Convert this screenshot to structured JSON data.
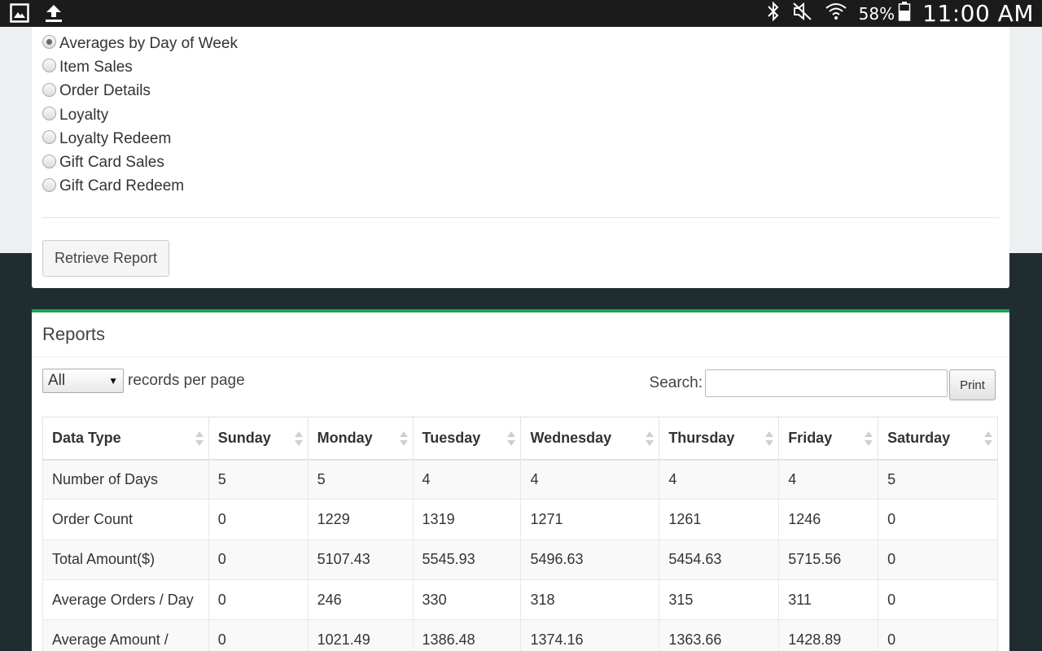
{
  "status_bar": {
    "left_icons": [
      "gallery-icon",
      "upload-icon"
    ],
    "right_icons": [
      "bluetooth-icon",
      "mute-icon",
      "wifi-icon",
      "battery-icon"
    ],
    "battery": "58%",
    "time": "11:00 AM"
  },
  "report_types": [
    {
      "label": "Averages by Day of Week",
      "checked": true
    },
    {
      "label": "Item Sales",
      "checked": false
    },
    {
      "label": "Order Details",
      "checked": false
    },
    {
      "label": "Loyalty",
      "checked": false
    },
    {
      "label": "Loyalty Redeem",
      "checked": false
    },
    {
      "label": "Gift Card Sales",
      "checked": false
    },
    {
      "label": "Gift Card Redeem",
      "checked": false
    }
  ],
  "retrieve_button": "Retrieve Report",
  "reports": {
    "title": "Reports",
    "page_size": "All",
    "records_label": "records per page",
    "search_label": "Search:",
    "search_value": "",
    "print_label": "Print",
    "columns": [
      "Data Type",
      "Sunday",
      "Monday",
      "Tuesday",
      "Wednesday",
      "Thursday",
      "Friday",
      "Saturday"
    ],
    "rows": [
      [
        "Number of Days",
        "5",
        "5",
        "4",
        "4",
        "4",
        "4",
        "5"
      ],
      [
        "Order Count",
        "0",
        "1229",
        "1319",
        "1271",
        "1261",
        "1246",
        "0"
      ],
      [
        "Total Amount($)",
        "0",
        "5107.43",
        "5545.93",
        "5496.63",
        "5454.63",
        "5715.56",
        "0"
      ],
      [
        "Average Orders / Day",
        "0",
        "246",
        "330",
        "318",
        "315",
        "311",
        "0"
      ],
      [
        "Average Amount /",
        "0",
        "1021.49",
        "1386.48",
        "1374.16",
        "1363.66",
        "1428.89",
        "0"
      ]
    ]
  },
  "colors": {
    "accent": "#1aa35a",
    "dark_background": "#1f2d30",
    "light_background": "#ecf0f1"
  }
}
